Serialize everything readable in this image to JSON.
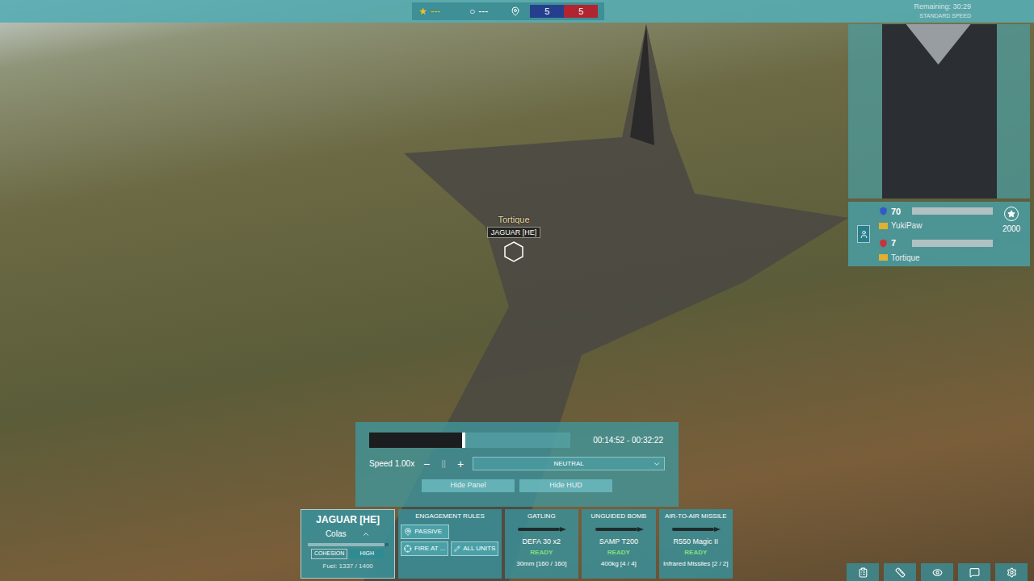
{
  "top_bar": {
    "stars": {
      "icon": "★",
      "value": "---"
    },
    "objectives": {
      "icon": "○",
      "value": "---"
    },
    "score": {
      "blue": "5",
      "red": "5"
    },
    "remaining": "Remaining: 30:29",
    "speed_mode": "STANDARD SPEED"
  },
  "scoreboard": {
    "players": [
      {
        "points": "70",
        "name": "YukiPaw",
        "color": "#3558c8"
      },
      {
        "points": "7",
        "name": "Tortique",
        "color": "#c8323c"
      }
    ],
    "total": "2000"
  },
  "unit_label": {
    "player": "Tortique",
    "unit": "JAGUAR [HE]"
  },
  "replay": {
    "level": 0.46,
    "time": "00:14:52 - 00:32:22",
    "speed": "Speed 1.00x",
    "minus": "−",
    "pause": "||",
    "plus": "+",
    "camera_mode": "NEUTRAL",
    "buttons": [
      "Hide Panel",
      "Hide HUD"
    ]
  },
  "unit_card": {
    "name": "JAGUAR [HE]",
    "pilot": "Colas",
    "cohesion_label": "COHESION",
    "cohesion": "HIGH",
    "cohesion_level": 0.95,
    "fuel": "Fuel: 1337 / 1400"
  },
  "engagement": {
    "title": "ENGAGEMENT RULES",
    "rules": [
      {
        "label": "PASSIVE",
        "kind": "pin"
      },
      {
        "label": "FIRE AT ...",
        "kind": "target"
      },
      {
        "label": "ALL UNITS",
        "kind": "pencil"
      }
    ]
  },
  "weapons": [
    {
      "category": "GATLING",
      "name": "DEFA 30 x2",
      "status": "READY",
      "ammo": "30mm [160 / 160]"
    },
    {
      "category": "UNGUIDED BOMB",
      "name": "SAMP T200",
      "status": "READY",
      "ammo": "400kg [4 / 4]"
    },
    {
      "category": "AIR-TO-AIR MISSILE",
      "name": "R550 Magic II",
      "status": "READY",
      "ammo": "Infrared Missiles [2 / 2]"
    }
  ]
}
